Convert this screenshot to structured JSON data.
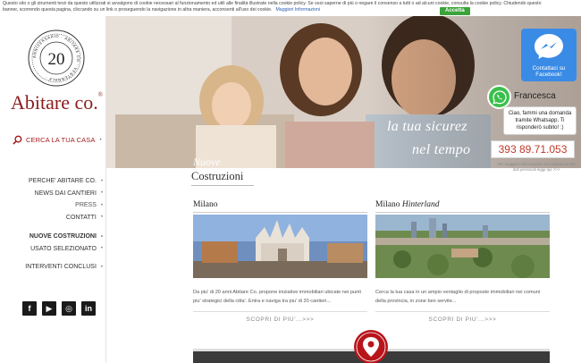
{
  "cookie_bar": {
    "text": "Questo sito o gli strumenti terzi da questo utilizzati si avvalgono di cookie necessari al funzionamento ed utili alle finalità illustrate nella cookie policy. Se vuoi saperne di più o negare il consenso a tutti o ad alcuni cookie, consulta la cookie policy. Chiudendo questo banner, scorrendo questa pagina, cliccando su un link o proseguendo la navigazione in altra maniera, acconsenti all'uso dei cookie.",
    "link_label": "Maggiori Informazioni",
    "accept_label": "Accetta"
  },
  "sidebar": {
    "seal_number": "20",
    "seal_ring_text": "ANNIVERSARIO · ABITARE CO · VENTENNALE ·",
    "brand": "Abitare co.",
    "search_label": "CERCA LA TUA CASA",
    "menu_group1": [
      "PERCHE' ABITARE CO.",
      "NEWS DAI CANTIERI",
      "PRESS",
      "CONTATTI"
    ],
    "menu_group2": [
      "NUOVE COSTRUZIONI",
      "USATO SELEZIONATO"
    ],
    "menu_group3": [
      "INTERVENTI CONCLUSI"
    ],
    "dot": "•",
    "socials": [
      "f",
      "▶",
      "◎",
      "in"
    ]
  },
  "hero": {
    "tagline_line1": "la tua sicurez",
    "tagline_line2": "nel tempo"
  },
  "section": {
    "title_line1": "Nuove",
    "title_line2": "Costruzioni"
  },
  "cards": [
    {
      "title": "Milano",
      "title_italic": "",
      "desc": "Da piu' di 20 anni Abitare Co. propone iniziative immobiliari ubicate nei punti piu' strategici della citta'. Entra e naviga tra piu' di 20 cantieri...",
      "more": "SCOPRI DI PIU'...>>>"
    },
    {
      "title": "Milano",
      "title_italic": "Hinterland",
      "desc": "Cerca la tua casa in un ampio ventaglio di proposte immobiliari nei comuni della provincia, in zone ben servite...",
      "more": "SCOPRI DI PIU'...>>>"
    }
  ],
  "chat": {
    "fb_label": "Contattaci su Facebook!",
    "wa_name": "Francesca",
    "wa_message": "Ciao, fammi una domanda tramite Whatsapp. Ti risponderò subito! :)",
    "wa_phone": "393 89.71.053",
    "wa_note": "Per maggiori informazioni sul trattamento dei dati personali leggi qui >>>"
  },
  "colors": {
    "brand_red": "#a31b1b",
    "accept_green": "#3aa33a",
    "fb_blue": "#3a8be6",
    "wa_green": "#3bbf4c"
  }
}
